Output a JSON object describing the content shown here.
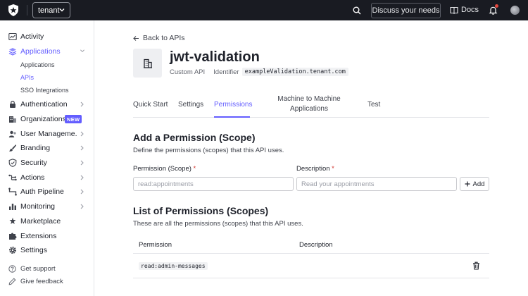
{
  "topbar": {
    "tenant": "tenant",
    "discuss_label": "Discuss your needs",
    "docs_label": "Docs"
  },
  "sidebar": {
    "items": [
      {
        "label": "Activity",
        "icon": "activity-icon"
      },
      {
        "label": "Applications",
        "icon": "applications-icon"
      },
      {
        "label": "Authentication",
        "icon": "authentication-icon"
      },
      {
        "label": "Organizations",
        "icon": "organizations-icon",
        "badge": "NEW"
      },
      {
        "label": "User Manageme...",
        "icon": "user-management-icon"
      },
      {
        "label": "Branding",
        "icon": "branding-icon"
      },
      {
        "label": "Security",
        "icon": "security-icon"
      },
      {
        "label": "Actions",
        "icon": "actions-icon"
      },
      {
        "label": "Auth Pipeline",
        "icon": "auth-pipeline-icon"
      },
      {
        "label": "Monitoring",
        "icon": "monitoring-icon"
      },
      {
        "label": "Marketplace",
        "icon": "marketplace-icon"
      },
      {
        "label": "Extensions",
        "icon": "extensions-icon"
      },
      {
        "label": "Settings",
        "icon": "settings-icon"
      }
    ],
    "sub_items": [
      "Applications",
      "APIs",
      "SSO Integrations"
    ],
    "footer": [
      "Get support",
      "Give feedback"
    ]
  },
  "page": {
    "back_label": "Back to APIs",
    "title": "jwt-validation",
    "type": "Custom API",
    "identifier_label": "Identifier",
    "identifier_value": "exampleValidation.tenant.com"
  },
  "tabs": [
    "Quick Start",
    "Settings",
    "Permissions",
    "Machine to Machine Applications",
    "Test"
  ],
  "add_permission": {
    "title": "Add a Permission (Scope)",
    "description": "Define the permissions (scopes) that this API uses.",
    "permission_label": "Permission (Scope)",
    "permission_placeholder": "read:appointments",
    "description_label": "Description",
    "description_placeholder": "Read your appointments",
    "required_mark": "*",
    "add_label": "Add"
  },
  "list": {
    "title": "List of Permissions (Scopes)",
    "description": "These are all the permissions (scopes) that this API uses.",
    "col_permission": "Permission",
    "col_description": "Description",
    "rows": [
      {
        "permission": "read:admin-messages",
        "description": ""
      }
    ]
  },
  "colors": {
    "accent": "#635dff",
    "topbar": "#191b22",
    "required": "#d0342c"
  }
}
